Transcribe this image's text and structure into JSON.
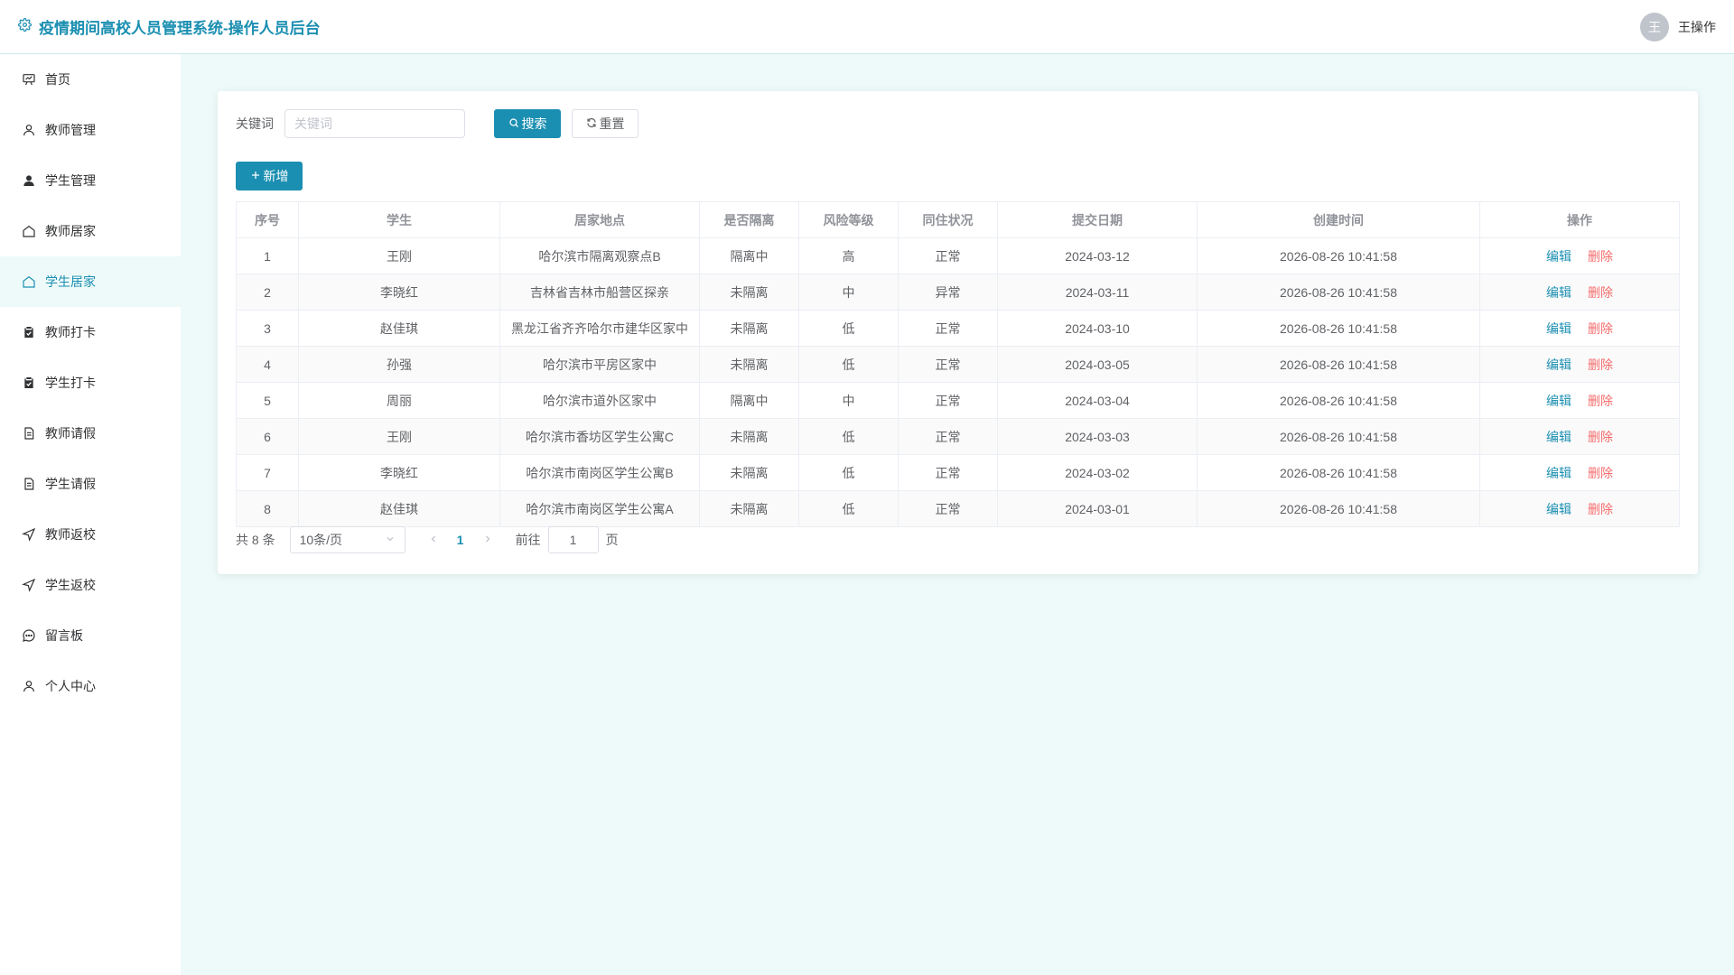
{
  "header": {
    "title": "疫情期间高校人员管理系统-操作人员后台",
    "avatar_text": "王",
    "username": "王操作"
  },
  "sidebar": {
    "items": [
      {
        "label": "首页",
        "icon": "home-board-icon"
      },
      {
        "label": "教师管理",
        "icon": "user-icon"
      },
      {
        "label": "学生管理",
        "icon": "user-filled-icon"
      },
      {
        "label": "教师居家",
        "icon": "house-icon"
      },
      {
        "label": "学生居家",
        "icon": "house-icon",
        "active": true
      },
      {
        "label": "教师打卡",
        "icon": "clipboard-check-icon"
      },
      {
        "label": "学生打卡",
        "icon": "clipboard-check-icon"
      },
      {
        "label": "教师请假",
        "icon": "document-icon"
      },
      {
        "label": "学生请假",
        "icon": "document-icon"
      },
      {
        "label": "教师返校",
        "icon": "send-icon"
      },
      {
        "label": "学生返校",
        "icon": "send-icon"
      },
      {
        "label": "留言板",
        "icon": "chat-icon"
      },
      {
        "label": "个人中心",
        "icon": "user-icon"
      }
    ]
  },
  "search": {
    "label": "关键词",
    "placeholder": "关键词",
    "value": "",
    "search_label": "搜索",
    "reset_label": "重置",
    "add_label": "新增"
  },
  "table": {
    "columns": [
      "序号",
      "学生",
      "居家地点",
      "是否隔离",
      "风险等级",
      "同住状况",
      "提交日期",
      "创建时间",
      "操作"
    ],
    "rows": [
      [
        "1",
        "王刚",
        "哈尔滨市隔离观察点B",
        "隔离中",
        "高",
        "正常",
        "2024-03-12",
        "2026-08-26 10:41:58"
      ],
      [
        "2",
        "李晓红",
        "吉林省吉林市船营区探亲",
        "未隔离",
        "中",
        "异常",
        "2024-03-11",
        "2026-08-26 10:41:58"
      ],
      [
        "3",
        "赵佳琪",
        "黑龙江省齐齐哈尔市建华区家中",
        "未隔离",
        "低",
        "正常",
        "2024-03-10",
        "2026-08-26 10:41:58"
      ],
      [
        "4",
        "孙强",
        "哈尔滨市平房区家中",
        "未隔离",
        "低",
        "正常",
        "2024-03-05",
        "2026-08-26 10:41:58"
      ],
      [
        "5",
        "周丽",
        "哈尔滨市道外区家中",
        "隔离中",
        "中",
        "正常",
        "2024-03-04",
        "2026-08-26 10:41:58"
      ],
      [
        "6",
        "王刚",
        "哈尔滨市香坊区学生公寓C",
        "未隔离",
        "低",
        "正常",
        "2024-03-03",
        "2026-08-26 10:41:58"
      ],
      [
        "7",
        "李晓红",
        "哈尔滨市南岗区学生公寓B",
        "未隔离",
        "低",
        "正常",
        "2024-03-02",
        "2026-08-26 10:41:58"
      ],
      [
        "8",
        "赵佳琪",
        "哈尔滨市南岗区学生公寓A",
        "未隔离",
        "低",
        "正常",
        "2024-03-01",
        "2026-08-26 10:41:58"
      ]
    ],
    "edit_label": "编辑",
    "delete_label": "删除"
  },
  "pagination": {
    "total_text": "共 8 条",
    "page_size": "10条/页",
    "current_page": "1",
    "goto_label": "前往",
    "goto_value": "1",
    "page_suffix": "页"
  },
  "colors": {
    "primary": "#1b8fb1",
    "danger": "#f56c6c",
    "background": "#eefaf9"
  }
}
